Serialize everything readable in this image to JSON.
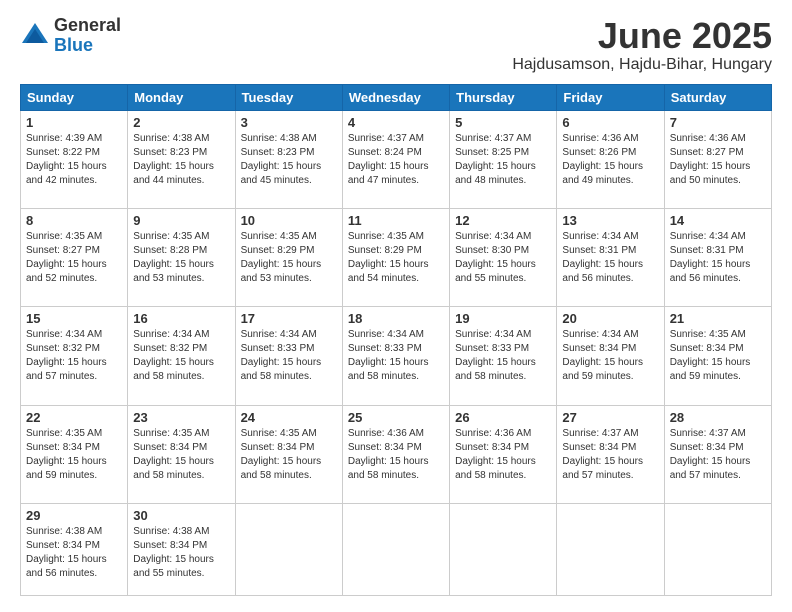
{
  "logo": {
    "general": "General",
    "blue": "Blue"
  },
  "header": {
    "month": "June 2025",
    "location": "Hajdusamson, Hajdu-Bihar, Hungary"
  },
  "weekdays": [
    "Sunday",
    "Monday",
    "Tuesday",
    "Wednesday",
    "Thursday",
    "Friday",
    "Saturday"
  ],
  "weeks": [
    [
      {
        "day": 1,
        "sunrise": "4:39 AM",
        "sunset": "8:22 PM",
        "daylight": "15 hours and 42 minutes."
      },
      {
        "day": 2,
        "sunrise": "4:38 AM",
        "sunset": "8:23 PM",
        "daylight": "15 hours and 44 minutes."
      },
      {
        "day": 3,
        "sunrise": "4:38 AM",
        "sunset": "8:23 PM",
        "daylight": "15 hours and 45 minutes."
      },
      {
        "day": 4,
        "sunrise": "4:37 AM",
        "sunset": "8:24 PM",
        "daylight": "15 hours and 47 minutes."
      },
      {
        "day": 5,
        "sunrise": "4:37 AM",
        "sunset": "8:25 PM",
        "daylight": "15 hours and 48 minutes."
      },
      {
        "day": 6,
        "sunrise": "4:36 AM",
        "sunset": "8:26 PM",
        "daylight": "15 hours and 49 minutes."
      },
      {
        "day": 7,
        "sunrise": "4:36 AM",
        "sunset": "8:27 PM",
        "daylight": "15 hours and 50 minutes."
      }
    ],
    [
      {
        "day": 8,
        "sunrise": "4:35 AM",
        "sunset": "8:27 PM",
        "daylight": "15 hours and 52 minutes."
      },
      {
        "day": 9,
        "sunrise": "4:35 AM",
        "sunset": "8:28 PM",
        "daylight": "15 hours and 53 minutes."
      },
      {
        "day": 10,
        "sunrise": "4:35 AM",
        "sunset": "8:29 PM",
        "daylight": "15 hours and 53 minutes."
      },
      {
        "day": 11,
        "sunrise": "4:35 AM",
        "sunset": "8:29 PM",
        "daylight": "15 hours and 54 minutes."
      },
      {
        "day": 12,
        "sunrise": "4:34 AM",
        "sunset": "8:30 PM",
        "daylight": "15 hours and 55 minutes."
      },
      {
        "day": 13,
        "sunrise": "4:34 AM",
        "sunset": "8:31 PM",
        "daylight": "15 hours and 56 minutes."
      },
      {
        "day": 14,
        "sunrise": "4:34 AM",
        "sunset": "8:31 PM",
        "daylight": "15 hours and 56 minutes."
      }
    ],
    [
      {
        "day": 15,
        "sunrise": "4:34 AM",
        "sunset": "8:32 PM",
        "daylight": "15 hours and 57 minutes."
      },
      {
        "day": 16,
        "sunrise": "4:34 AM",
        "sunset": "8:32 PM",
        "daylight": "15 hours and 58 minutes."
      },
      {
        "day": 17,
        "sunrise": "4:34 AM",
        "sunset": "8:33 PM",
        "daylight": "15 hours and 58 minutes."
      },
      {
        "day": 18,
        "sunrise": "4:34 AM",
        "sunset": "8:33 PM",
        "daylight": "15 hours and 58 minutes."
      },
      {
        "day": 19,
        "sunrise": "4:34 AM",
        "sunset": "8:33 PM",
        "daylight": "15 hours and 58 minutes."
      },
      {
        "day": 20,
        "sunrise": "4:34 AM",
        "sunset": "8:34 PM",
        "daylight": "15 hours and 59 minutes."
      },
      {
        "day": 21,
        "sunrise": "4:35 AM",
        "sunset": "8:34 PM",
        "daylight": "15 hours and 59 minutes."
      }
    ],
    [
      {
        "day": 22,
        "sunrise": "4:35 AM",
        "sunset": "8:34 PM",
        "daylight": "15 hours and 59 minutes."
      },
      {
        "day": 23,
        "sunrise": "4:35 AM",
        "sunset": "8:34 PM",
        "daylight": "15 hours and 58 minutes."
      },
      {
        "day": 24,
        "sunrise": "4:35 AM",
        "sunset": "8:34 PM",
        "daylight": "15 hours and 58 minutes."
      },
      {
        "day": 25,
        "sunrise": "4:36 AM",
        "sunset": "8:34 PM",
        "daylight": "15 hours and 58 minutes."
      },
      {
        "day": 26,
        "sunrise": "4:36 AM",
        "sunset": "8:34 PM",
        "daylight": "15 hours and 58 minutes."
      },
      {
        "day": 27,
        "sunrise": "4:37 AM",
        "sunset": "8:34 PM",
        "daylight": "15 hours and 57 minutes."
      },
      {
        "day": 28,
        "sunrise": "4:37 AM",
        "sunset": "8:34 PM",
        "daylight": "15 hours and 57 minutes."
      }
    ],
    [
      {
        "day": 29,
        "sunrise": "4:38 AM",
        "sunset": "8:34 PM",
        "daylight": "15 hours and 56 minutes."
      },
      {
        "day": 30,
        "sunrise": "4:38 AM",
        "sunset": "8:34 PM",
        "daylight": "15 hours and 55 minutes."
      },
      null,
      null,
      null,
      null,
      null
    ]
  ]
}
